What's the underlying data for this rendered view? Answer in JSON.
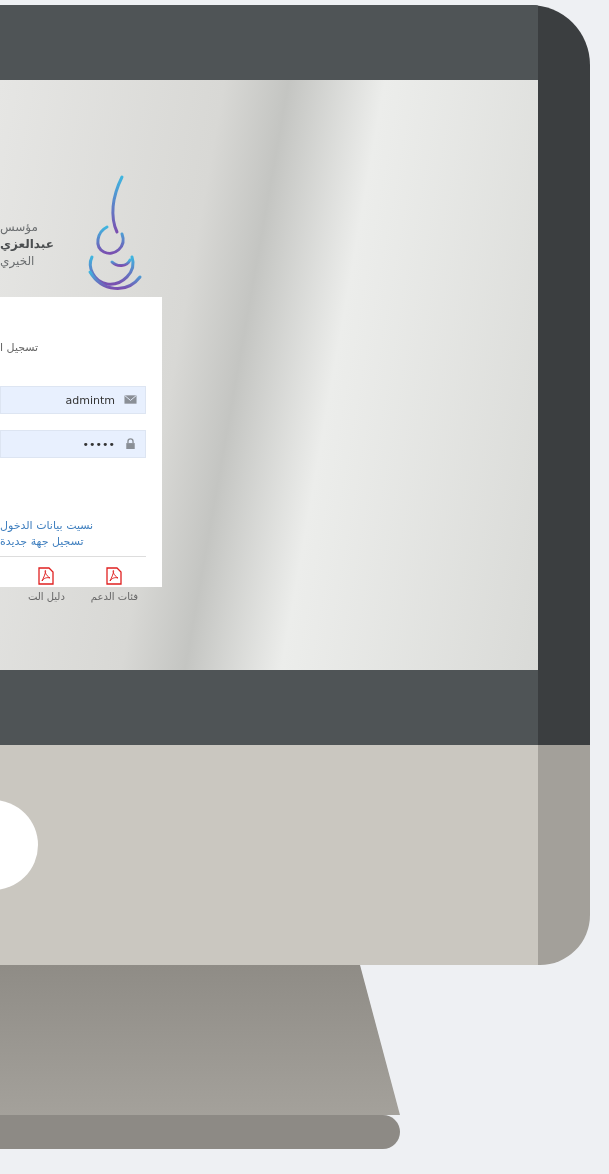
{
  "logo": {
    "lines": [
      "مؤسس",
      "عبدالعزي",
      "الخيري"
    ]
  },
  "login": {
    "title": "تسجيل ا",
    "fields": [
      {
        "kind": "email",
        "value": "admintm"
      },
      {
        "kind": "password",
        "value": "•••••"
      }
    ],
    "links": [
      "نسيت بيانات الدخول",
      "تسجيل جهة جديدة"
    ],
    "documents": [
      "فئات الدعم",
      "دليل الت"
    ]
  }
}
